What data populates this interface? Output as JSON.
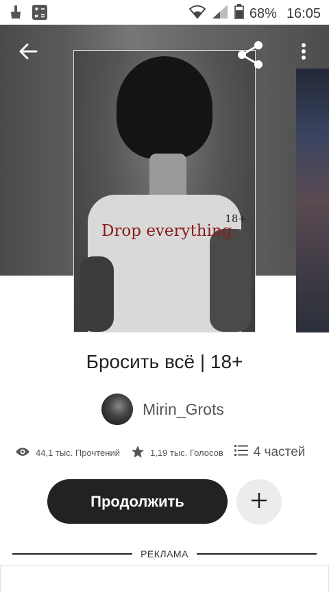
{
  "status_bar": {
    "battery": "68%",
    "time": "16:05",
    "icons": [
      "cleaner-icon",
      "calculator-icon",
      "wifi-icon",
      "signal-icon",
      "battery-icon"
    ]
  },
  "toolbar": {
    "back_icon": "arrow-left-icon",
    "share_icon": "share-icon",
    "menu_icon": "more-vertical-icon"
  },
  "cover": {
    "title": "Drop everything.",
    "age": "18+"
  },
  "story": {
    "title": "Бросить всё | 18+",
    "author": "Mirin_Grots"
  },
  "stats": {
    "reads": "44,1 тыс. Прочтений",
    "votes": "1,19 тыс. Голосов",
    "parts": "4 частей"
  },
  "actions": {
    "continue_label": "Продолжить",
    "add_label": "+"
  },
  "ad": {
    "label": "РЕКЛАМА"
  },
  "colors": {
    "primary_button": "#222222",
    "secondary_button": "#ececec",
    "cover_title": "#8b1a1a"
  }
}
